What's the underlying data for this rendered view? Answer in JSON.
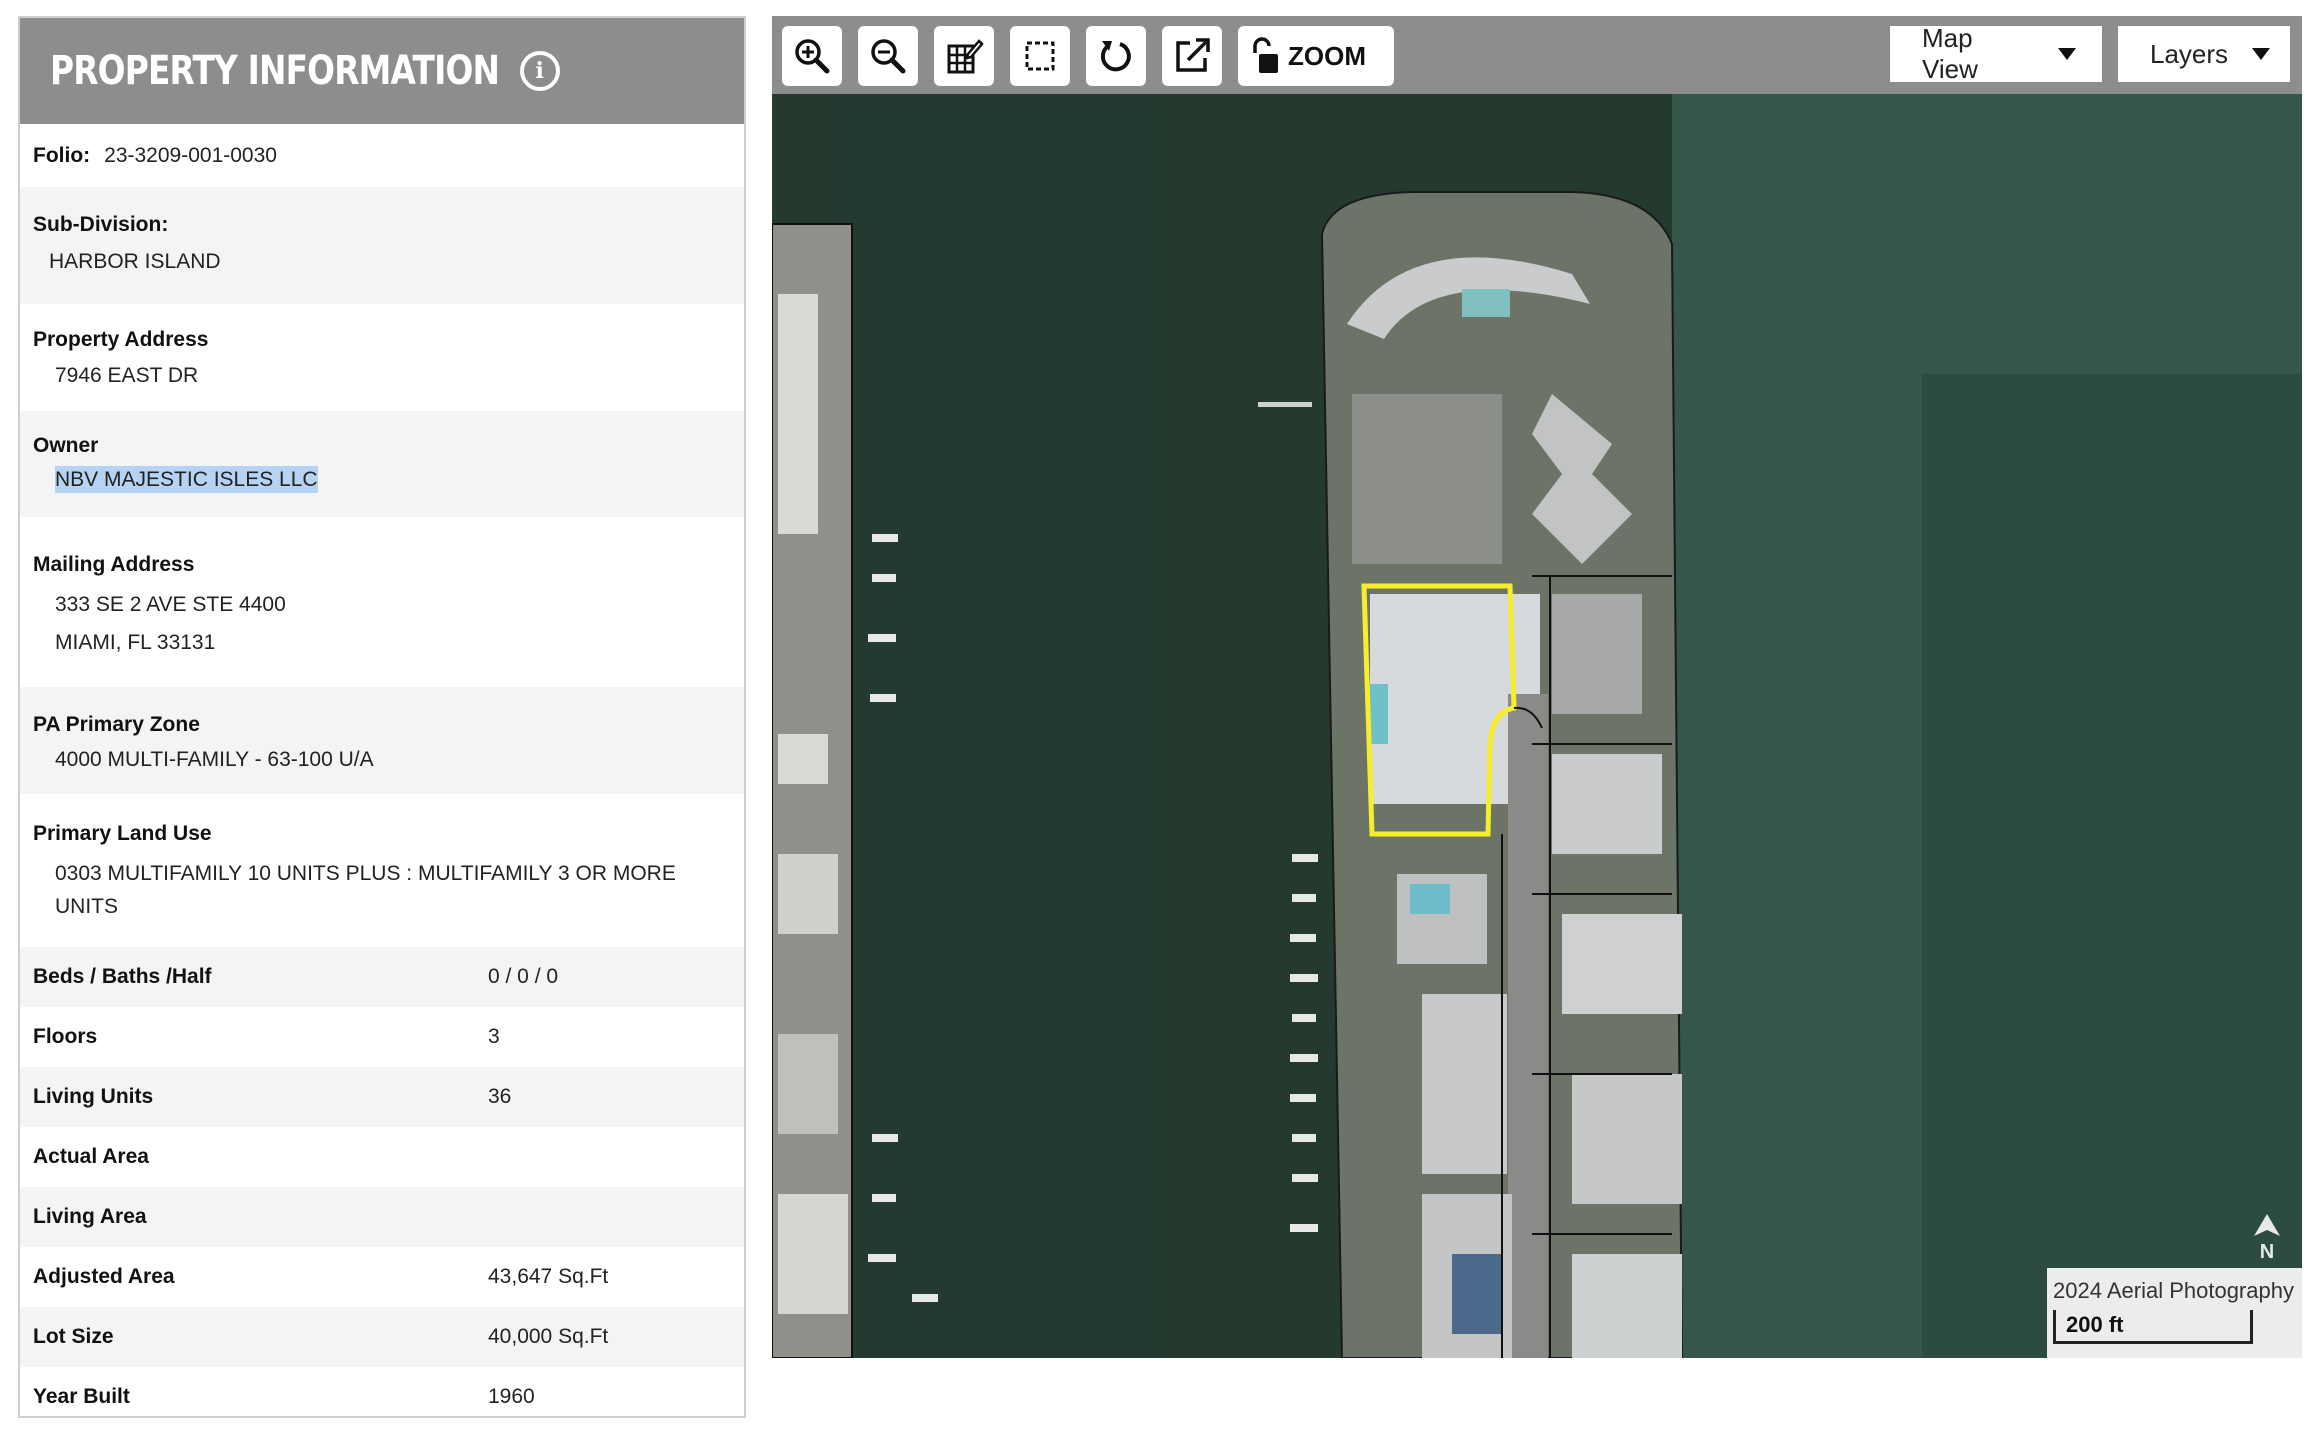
{
  "panel": {
    "title": "PROPERTY INFORMATION",
    "info_icon": "info-icon"
  },
  "folio": {
    "label": "Folio:",
    "value": "23-3209-001-0030"
  },
  "subdivision": {
    "label": "Sub-Division:",
    "value": "HARBOR ISLAND"
  },
  "address": {
    "label": "Property Address",
    "value": "7946 EAST DR"
  },
  "owner": {
    "label": "Owner",
    "value": "NBV MAJESTIC ISLES LLC"
  },
  "mailing": {
    "label": "Mailing Address",
    "line1": "333 SE 2 AVE STE 4400",
    "line2": "MIAMI, FL 33131"
  },
  "zone": {
    "label": "PA Primary Zone",
    "value": "4000 MULTI-FAMILY - 63-100 U/A"
  },
  "landuse": {
    "label": "Primary Land Use",
    "value": "0303 MULTIFAMILY 10 UNITS PLUS : MULTIFAMILY 3 OR MORE UNITS"
  },
  "details": [
    {
      "label": "Beds / Baths /Half",
      "value": "0 / 0 / 0"
    },
    {
      "label": "Floors",
      "value": "3"
    },
    {
      "label": "Living Units",
      "value": "36"
    },
    {
      "label": "Actual Area",
      "value": ""
    },
    {
      "label": "Living Area",
      "value": ""
    },
    {
      "label": "Adjusted Area",
      "value": "43,647 Sq.Ft"
    },
    {
      "label": "Lot Size",
      "value": "40,000 Sq.Ft"
    },
    {
      "label": "Year Built",
      "value": "1960"
    }
  ],
  "toolbar": {
    "icons": [
      "zoom-in-icon",
      "zoom-out-icon",
      "edit-map-icon",
      "select-area-icon",
      "refresh-icon",
      "external-link-icon",
      "unlock-icon"
    ],
    "zoom_label": "ZOOM",
    "map_view_label": "Map View",
    "layers_label": "Layers"
  },
  "map": {
    "attribution": "2024 Aerial Photography",
    "scale_label": "200 ft",
    "north_label": "N",
    "highlight_color": "#f7ee2b"
  }
}
